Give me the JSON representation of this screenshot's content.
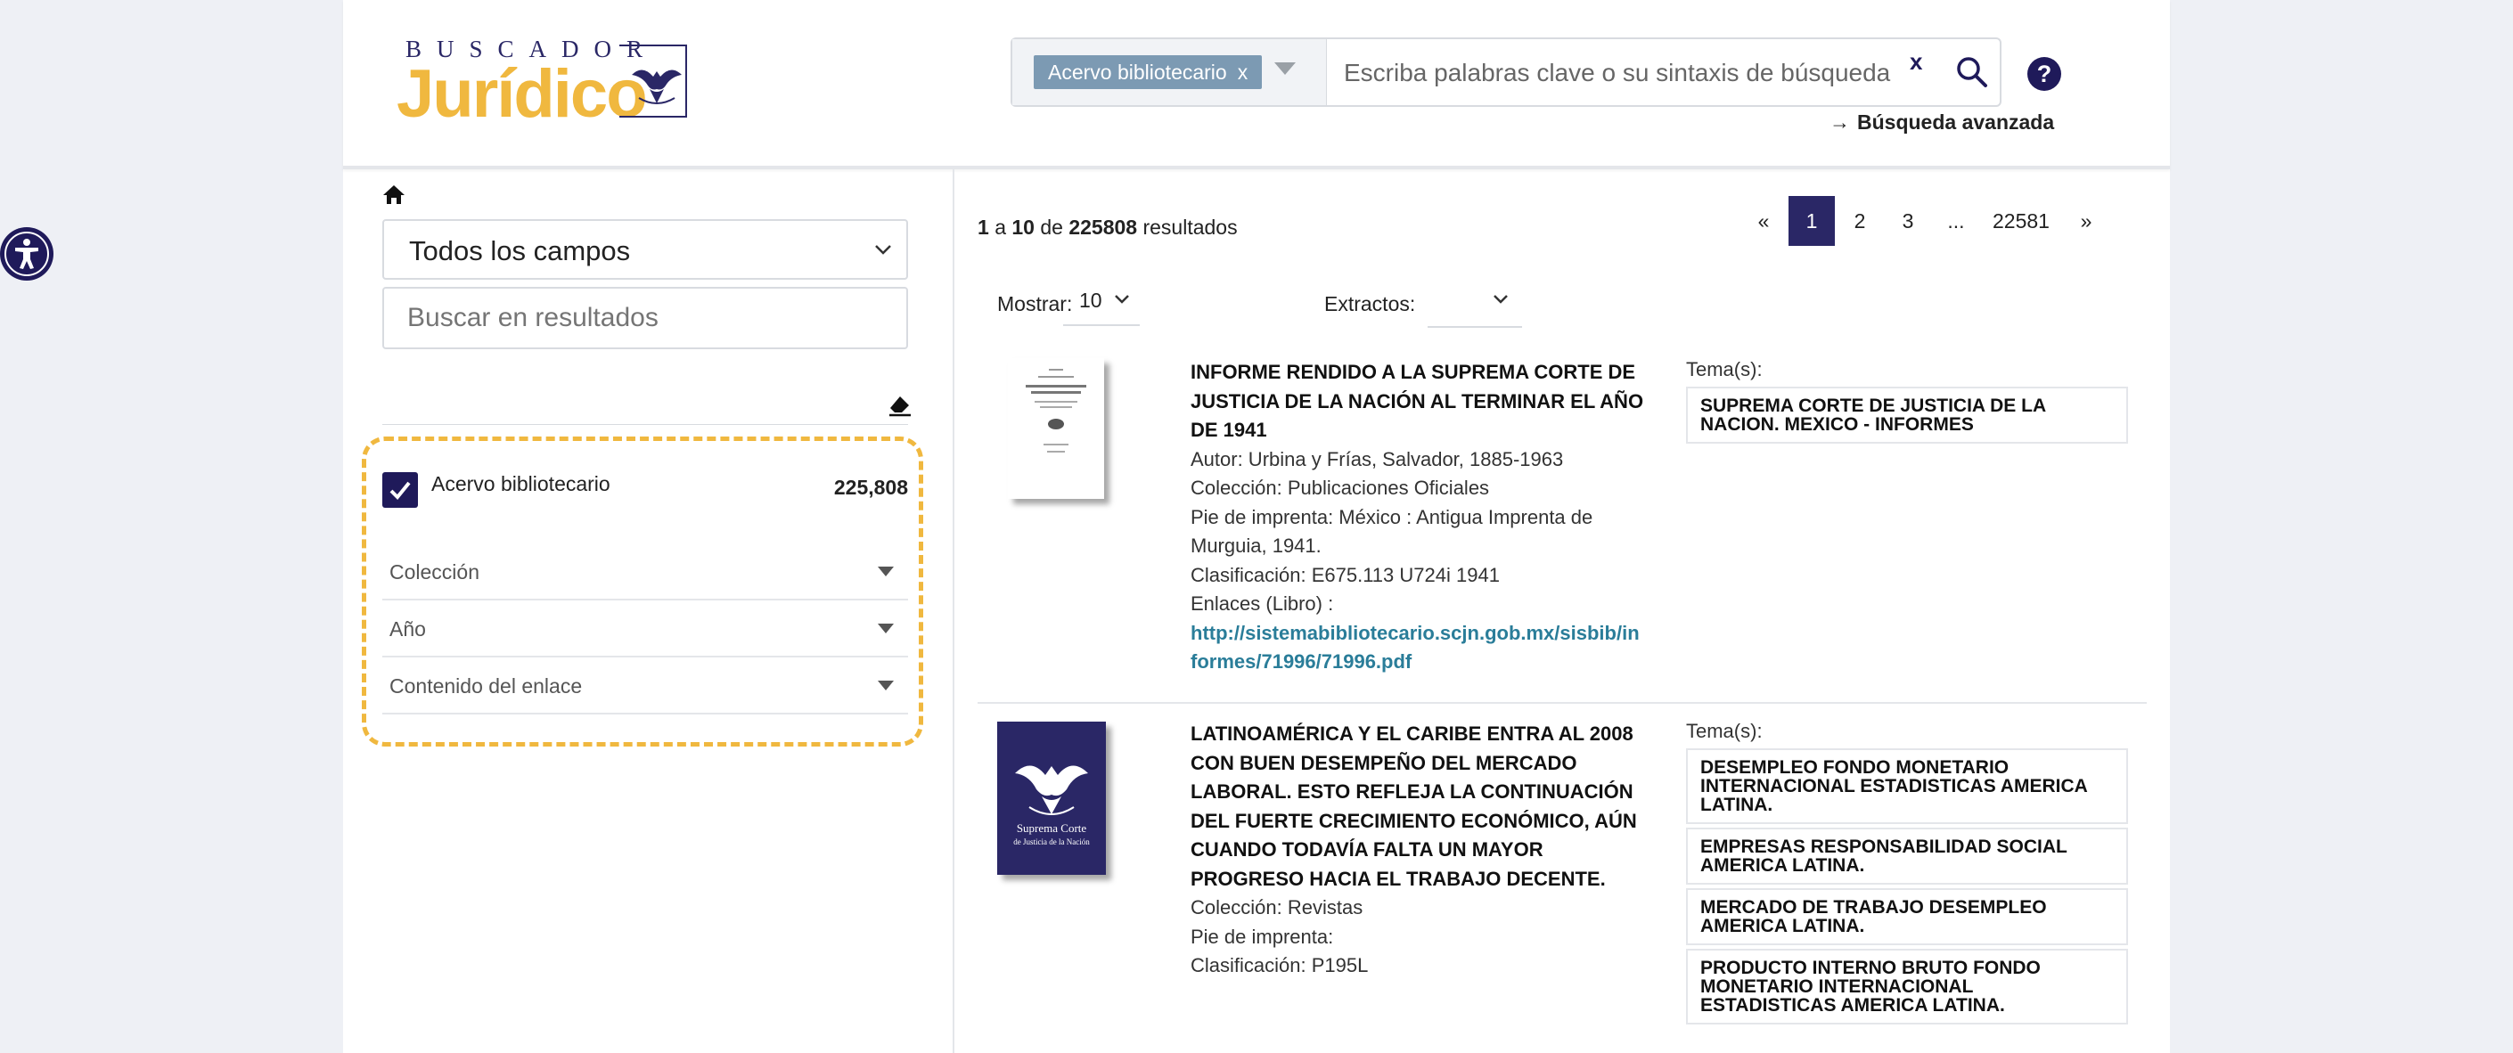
{
  "header": {
    "logo_top": "BUSCADOR",
    "logo_main": "Jurídico",
    "search": {
      "chip_label": "Acervo bibliotecario",
      "chip_close": "x",
      "placeholder": "Escriba palabras clave o su sintaxis de búsqueda",
      "clear_label": "x"
    },
    "help_label": "?",
    "advanced_label": "Búsqueda avanzada"
  },
  "sidebar": {
    "field_select": "Todos los campos",
    "search_placeholder": "Buscar en resultados",
    "facet_checkbox": {
      "label": "Acervo bibliotecario",
      "count": "225,808",
      "checked": true
    },
    "facets": [
      "Colección",
      "Año",
      "Contenido del enlace"
    ]
  },
  "results_bar": {
    "from": "1",
    "sep1": "a",
    "to": "10",
    "sep2": "de",
    "total": "225808",
    "suffix": "resultados",
    "pagination": [
      "«",
      "1",
      "2",
      "3",
      "...",
      "22581",
      "»"
    ],
    "active_page": "1",
    "show_label": "Mostrar:",
    "show_value": "10",
    "extracts_label": "Extractos:"
  },
  "results": [
    {
      "title": "INFORME RENDIDO A LA SUPREMA CORTE DE JUSTICIA DE LA NACIÓN AL TERMINAR EL AÑO DE 1941",
      "lines": [
        "Autor: Urbina y Frías, Salvador, 1885-1963",
        "Colección: Publicaciones Oficiales",
        "Pie de imprenta: México : Antigua Imprenta de Murguia, 1941.",
        "Clasificación: E675.113 U724i 1941",
        "Enlaces (Libro) :"
      ],
      "link": "http://sistemabibliotecario.scjn.gob.mx/sisbib/informes/71996/71996.pdf",
      "temas_label": "Tema(s):",
      "temas": [
        "SUPREMA CORTE DE JUSTICIA DE LA NACION. MEXICO - INFORMES"
      ]
    },
    {
      "title": "LATINOAMÉRICA Y EL CARIBE ENTRA AL 2008 CON BUEN DESEMPEÑO DEL MERCADO LABORAL. ESTO REFLEJA LA CONTINUACIÓN DEL FUERTE CRECIMIENTO ECONÓMICO, AÚN CUANDO TODAVÍA FALTA UN MAYOR PROGRESO HACIA EL TRABAJO DECENTE.",
      "lines": [
        "Colección: Revistas",
        "Pie de imprenta:",
        "Clasificación: P195L"
      ],
      "temas_label": "Tema(s):",
      "temas": [
        "DESEMPLEO FONDO MONETARIO INTERNACIONAL ESTADISTICAS AMERICA LATINA.",
        "EMPRESAS RESPONSABILIDAD SOCIAL AMERICA LATINA.",
        "MERCADO DE TRABAJO DESEMPLEO AMERICA LATINA.",
        "PRODUCTO INTERNO BRUTO FONDO MONETARIO INTERNACIONAL ESTADISTICAS AMERICA LATINA."
      ],
      "cover_text_1": "Suprema Corte",
      "cover_text_2": "de Justicia de la Nación"
    }
  ],
  "colors": {
    "navy": "#1f1a5a",
    "gold": "#f0b83f",
    "chip": "#7c9ab3",
    "link": "#2a7d99"
  },
  "icons": [
    "accessibility-icon",
    "home-icon",
    "search-icon",
    "eraser-icon",
    "chevron-down-icon",
    "caret-down-icon",
    "check-icon",
    "eagle-icon"
  ]
}
